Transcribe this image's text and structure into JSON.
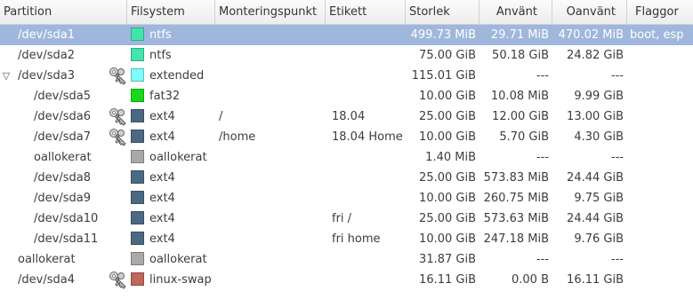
{
  "columns": {
    "partition": "Partition",
    "filesystem": "Filsystem",
    "mountpoint": "Monteringspunkt",
    "label": "Etikett",
    "size": "Storlek",
    "used": "Använt",
    "unused": "Oanvänt",
    "flags": "Flaggor"
  },
  "rows": [
    {
      "partition": "/dev/sda1",
      "indent": 1,
      "expander": "",
      "locked": false,
      "fs": "ntfs",
      "fs_color": "#42e5ac",
      "mount": "",
      "label": "",
      "size": "499.73 MiB",
      "used": "29.71 MiB",
      "unused": "470.02 MiB",
      "flags": "boot, esp",
      "selected": true
    },
    {
      "partition": "/dev/sda2",
      "indent": 1,
      "expander": "",
      "locked": false,
      "fs": "ntfs",
      "fs_color": "#42e5ac",
      "mount": "",
      "label": "",
      "size": "75.00 GiB",
      "used": "50.18 GiB",
      "unused": "24.82 GiB",
      "flags": "",
      "selected": false
    },
    {
      "partition": "/dev/sda3",
      "indent": 1,
      "expander": "▽",
      "locked": true,
      "fs": "extended",
      "fs_color": "#7dfcfe",
      "mount": "",
      "label": "",
      "size": "115.01 GiB",
      "used": "---",
      "unused": "---",
      "flags": "",
      "selected": false
    },
    {
      "partition": "/dev/sda5",
      "indent": 2,
      "expander": "",
      "locked": false,
      "fs": "fat32",
      "fs_color": "#18d918",
      "mount": "",
      "label": "",
      "size": "10.00 GiB",
      "used": "10.08 MiB",
      "unused": "9.99 GiB",
      "flags": "",
      "selected": false
    },
    {
      "partition": "/dev/sda6",
      "indent": 2,
      "expander": "",
      "locked": true,
      "fs": "ext4",
      "fs_color": "#4b6983",
      "mount": "/",
      "label": "18.04",
      "size": "25.00 GiB",
      "used": "12.00 GiB",
      "unused": "13.00 GiB",
      "flags": "",
      "selected": false
    },
    {
      "partition": "/dev/sda7",
      "indent": 2,
      "expander": "",
      "locked": true,
      "fs": "ext4",
      "fs_color": "#4b6983",
      "mount": "/home",
      "label": "18.04 Home",
      "size": "10.00 GiB",
      "used": "5.70 GiB",
      "unused": "4.30 GiB",
      "flags": "",
      "selected": false
    },
    {
      "partition": "oallokerat",
      "indent": 2,
      "expander": "",
      "locked": false,
      "fs": "oallokerat",
      "fs_color": "#a9a9a9",
      "mount": "",
      "label": "",
      "size": "1.40 MiB",
      "used": "---",
      "unused": "---",
      "flags": "",
      "selected": false
    },
    {
      "partition": "/dev/sda8",
      "indent": 2,
      "expander": "",
      "locked": false,
      "fs": "ext4",
      "fs_color": "#4b6983",
      "mount": "",
      "label": "",
      "size": "25.00 GiB",
      "used": "573.83 MiB",
      "unused": "24.44 GiB",
      "flags": "",
      "selected": false
    },
    {
      "partition": "/dev/sda9",
      "indent": 2,
      "expander": "",
      "locked": false,
      "fs": "ext4",
      "fs_color": "#4b6983",
      "mount": "",
      "label": "",
      "size": "10.00 GiB",
      "used": "260.75 MiB",
      "unused": "9.75 GiB",
      "flags": "",
      "selected": false
    },
    {
      "partition": "/dev/sda10",
      "indent": 2,
      "expander": "",
      "locked": false,
      "fs": "ext4",
      "fs_color": "#4b6983",
      "mount": "",
      "label": "fri /",
      "size": "25.00 GiB",
      "used": "573.63 MiB",
      "unused": "24.44 GiB",
      "flags": "",
      "selected": false
    },
    {
      "partition": "/dev/sda11",
      "indent": 2,
      "expander": "",
      "locked": false,
      "fs": "ext4",
      "fs_color": "#4b6983",
      "mount": "",
      "label": "fri home",
      "size": "10.00 GiB",
      "used": "247.18 MiB",
      "unused": "9.76 GiB",
      "flags": "",
      "selected": false
    },
    {
      "partition": "oallokerat",
      "indent": 1,
      "expander": "",
      "locked": false,
      "fs": "oallokerat",
      "fs_color": "#a9a9a9",
      "mount": "",
      "label": "",
      "size": "31.87 GiB",
      "used": "---",
      "unused": "---",
      "flags": "",
      "selected": false
    },
    {
      "partition": "/dev/sda4",
      "indent": 1,
      "expander": "",
      "locked": true,
      "fs": "linux-swap",
      "fs_color": "#c1665a",
      "mount": "",
      "label": "",
      "size": "16.11 GiB",
      "used": "0.00 B",
      "unused": "16.11 GiB",
      "flags": "",
      "selected": false
    }
  ]
}
